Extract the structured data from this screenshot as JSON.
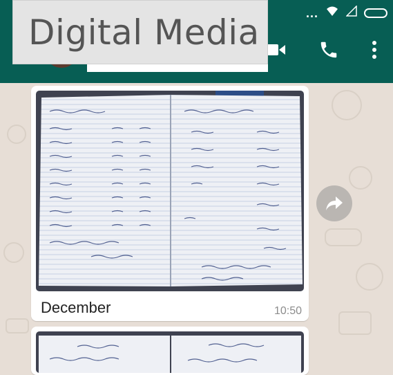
{
  "overlay": {
    "title": "Digital Media"
  },
  "header": {
    "icons": [
      "video-call-icon",
      "voice-call-icon",
      "overflow-menu-icon"
    ]
  },
  "status_bar": {
    "icons": [
      "more-dots-icon",
      "wifi-icon",
      "signal-icon",
      "battery-icon"
    ]
  },
  "messages": [
    {
      "type": "image",
      "caption": "December",
      "time": "10:50"
    },
    {
      "type": "image",
      "caption": "",
      "time": ""
    }
  ],
  "actions": {
    "forward_icon": "forward-arrow-icon"
  },
  "colors": {
    "header": "#075e54",
    "chat_background": "#e7ded6",
    "bubble": "#ffffff"
  }
}
